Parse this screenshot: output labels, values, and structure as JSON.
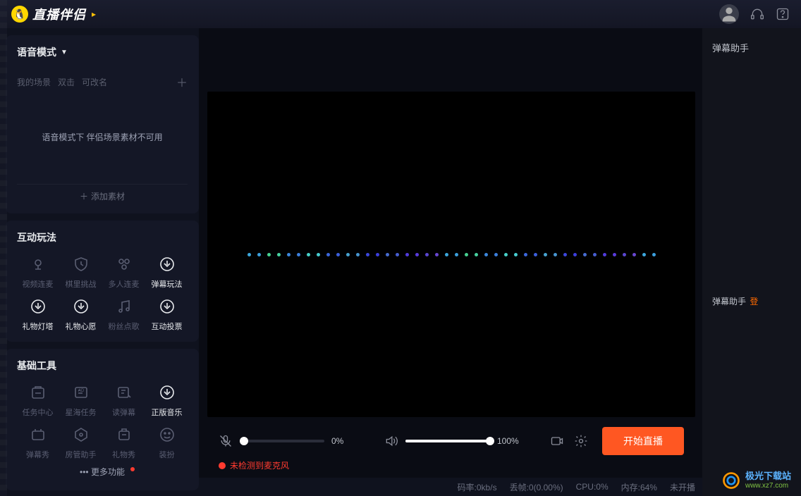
{
  "header": {
    "logo_text": "直播伴侣"
  },
  "mode": {
    "title": "语音模式",
    "scene_label": "我的场景",
    "scene_hint_1": "双击",
    "scene_hint_2": "可改名",
    "unavailable_hint": "语音模式下 伴侣场景素材不可用",
    "add_material": "添加素材"
  },
  "interactive": {
    "title": "互动玩法",
    "items": [
      {
        "label": "视频连麦",
        "active": false
      },
      {
        "label": "棋里挑战",
        "active": false
      },
      {
        "label": "多人连麦",
        "active": false
      },
      {
        "label": "弹幕玩法",
        "active": true
      },
      {
        "label": "礼物灯塔",
        "active": true
      },
      {
        "label": "礼物心愿",
        "active": true
      },
      {
        "label": "粉丝点歌",
        "active": false
      },
      {
        "label": "互动投票",
        "active": true
      }
    ]
  },
  "basic": {
    "title": "基础工具",
    "items": [
      {
        "label": "任务中心",
        "active": false
      },
      {
        "label": "星海任务",
        "active": false
      },
      {
        "label": "读弹幕",
        "active": false
      },
      {
        "label": "正版音乐",
        "active": true
      },
      {
        "label": "弹幕秀",
        "active": false
      },
      {
        "label": "房管助手",
        "active": false
      },
      {
        "label": "礼物秀",
        "active": false
      },
      {
        "label": "装扮",
        "active": false
      }
    ],
    "more": "更多功能"
  },
  "controls": {
    "mic_pct": "0%",
    "speaker_pct": "100%",
    "mic_warning": "未检测到麦克风",
    "start_button": "开始直播"
  },
  "status": {
    "bitrate": "码率:0kb/s",
    "dropframe": "丢帧:0(0.00%)",
    "cpu": "CPU:0%",
    "memory": "内存:64%",
    "broadcast": "未开播"
  },
  "right": {
    "title": "弹幕助手",
    "login_label": "弹幕助手",
    "login_link": "登"
  },
  "watermark": {
    "cn": "极光下载站",
    "url": "www.xz7.com"
  }
}
